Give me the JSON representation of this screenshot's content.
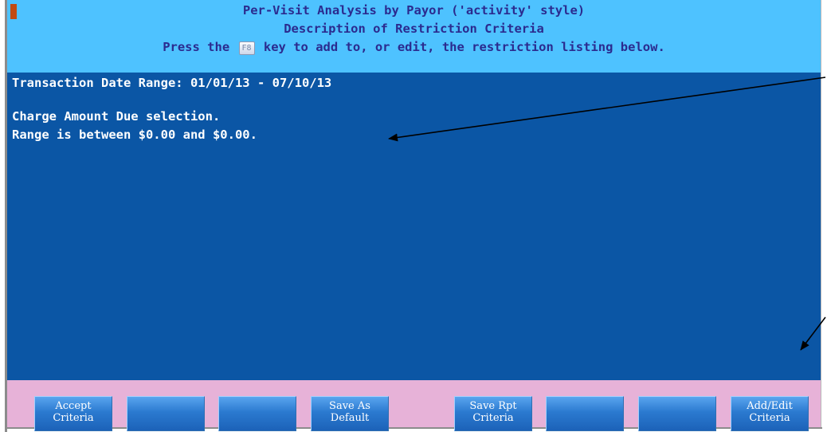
{
  "header": {
    "title": "Per-Visit Analysis by Payor ('activity' style)",
    "subtitle": "Description of Restriction Criteria",
    "instruction_prefix": "Press the",
    "instruction_key": "F8",
    "instruction_suffix": "key to add to, or edit, the restriction listing below."
  },
  "criteria": {
    "date_range_line": "Transaction Date Range: 01/01/13 - 07/10/13",
    "charge_selection_line": "Charge Amount Due selection.",
    "range_line": "Range is between $0.00 and $0.00."
  },
  "function_keys": [
    {
      "line1": "Accept",
      "line2": "Criteria"
    },
    {
      "line1": "",
      "line2": ""
    },
    {
      "line1": "",
      "line2": ""
    },
    {
      "line1": "Save As",
      "line2": "Default"
    },
    {
      "line1": "Save Rpt",
      "line2": "Criteria"
    },
    {
      "line1": "",
      "line2": ""
    },
    {
      "line1": "",
      "line2": ""
    },
    {
      "line1": "Add/Edit",
      "line2": "Criteria"
    }
  ],
  "colors": {
    "header_bg": "#4ec2ff",
    "header_text": "#2b2b8f",
    "panel_bg": "#0b56a5",
    "panel_text": "#ffffff",
    "footer_bg": "#e7b2d8",
    "button_bg": "#2b7ad0",
    "marker": "#c24a12"
  }
}
